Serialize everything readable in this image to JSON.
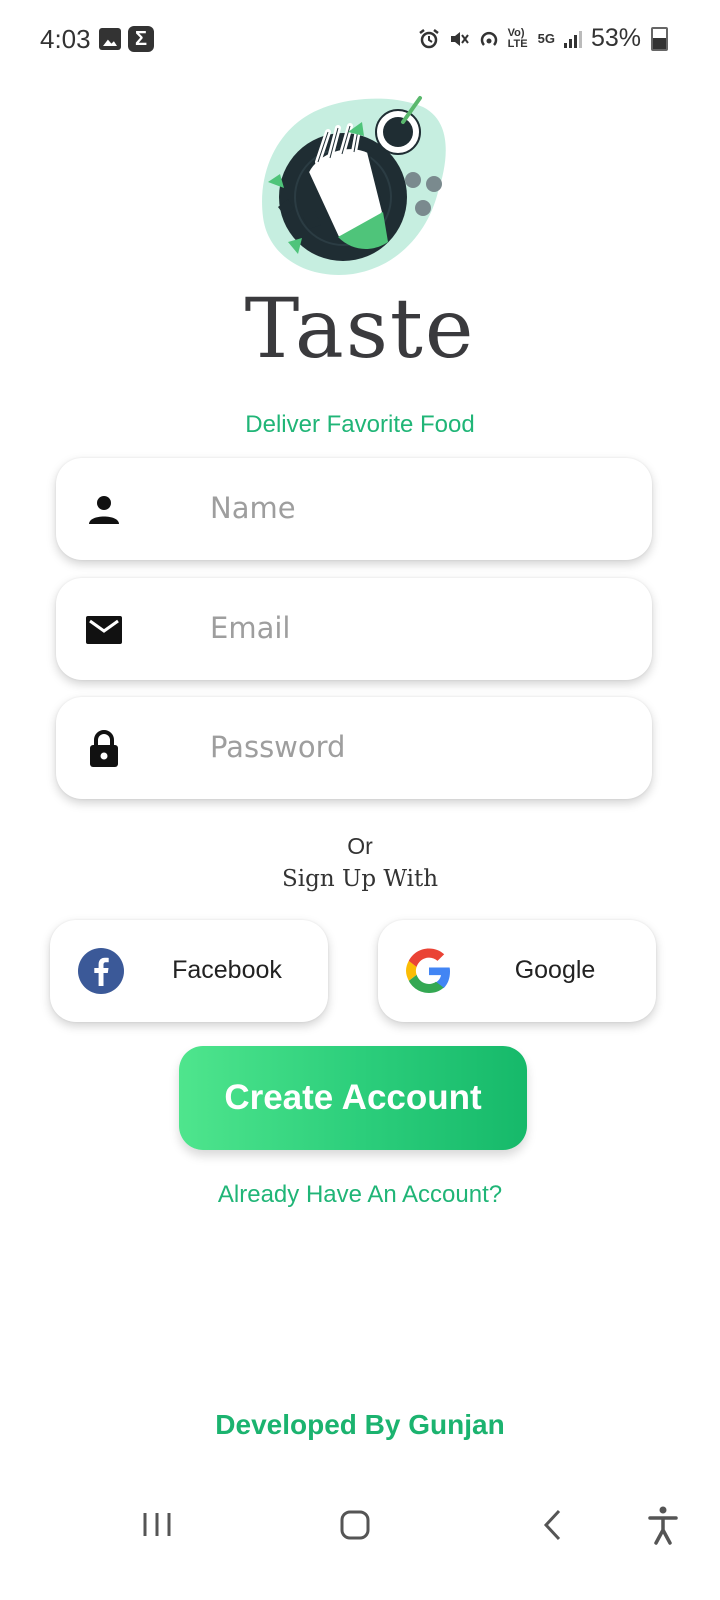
{
  "status_bar": {
    "time": "4:03",
    "signal_label": "5G",
    "volte_label": "Vo) LTE",
    "battery": "53%"
  },
  "app": {
    "brand": "Taste",
    "tagline": "Deliver Favorite Food"
  },
  "form": {
    "name_placeholder": "Name",
    "email_placeholder": "Email",
    "password_placeholder": "Password",
    "name_icon": "person-icon",
    "email_icon": "mail-icon",
    "password_icon": "lock-icon"
  },
  "divider": {
    "or": "Or",
    "sign_up_with": "Sign Up With"
  },
  "social": {
    "facebook_label": "Facebook",
    "google_label": "Google"
  },
  "actions": {
    "create_account": "Create Account",
    "already_have_account": "Already Have An Account?"
  },
  "footer": {
    "developed_by": "Developed By Gunjan"
  },
  "colors": {
    "accent_green": "#20b577",
    "button_gradient_start": "#4fe58d",
    "button_gradient_end": "#16b96a",
    "facebook_blue": "#3b5998"
  }
}
